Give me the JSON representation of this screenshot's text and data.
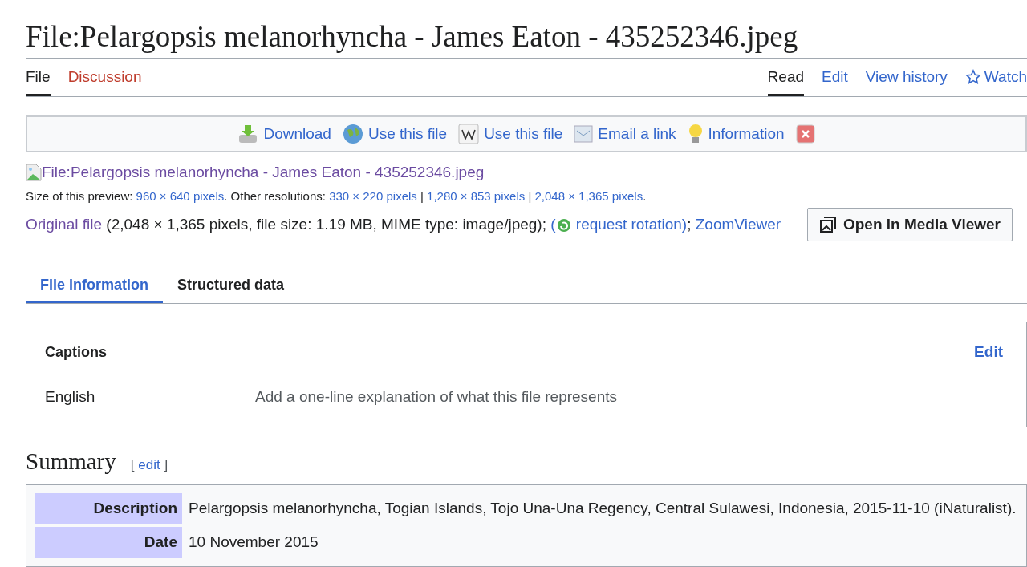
{
  "title": "File:Pelargopsis melanorhyncha - James Eaton - 435252346.jpeg",
  "namespace_tabs": [
    {
      "label": "File",
      "selected": true,
      "kind": "page"
    },
    {
      "label": "Discussion",
      "selected": false,
      "kind": "missing"
    }
  ],
  "view_tabs": [
    {
      "label": "Read",
      "selected": true,
      "kind": "plain"
    },
    {
      "label": "Edit",
      "selected": false,
      "kind": "plain"
    },
    {
      "label": "View history",
      "selected": false,
      "kind": "plain"
    },
    {
      "label": "Watch",
      "selected": false,
      "kind": "star"
    }
  ],
  "toolbar": [
    {
      "label": "Download",
      "kind": "download"
    },
    {
      "label": "Use this file",
      "kind": "globe"
    },
    {
      "label": "Use this file",
      "kind": "wiki"
    },
    {
      "label": "Email a link",
      "kind": "email"
    },
    {
      "label": "Information",
      "kind": "bulb"
    },
    {
      "kind": "close"
    }
  ],
  "preview_link": "File:Pelargopsis melanorhyncha - James Eaton - 435252346.jpeg",
  "size_line": [
    {
      "kind": "text",
      "text": "Size of this preview: "
    },
    {
      "kind": "link",
      "text": "960 × 640 pixels"
    },
    {
      "kind": "text",
      "text": ". Other resolutions: "
    },
    {
      "kind": "link",
      "text": "330 × 220 pixels"
    },
    {
      "kind": "text",
      "text": " | "
    },
    {
      "kind": "link",
      "text": "1,280 × 853 pixels"
    },
    {
      "kind": "text",
      "text": " | "
    },
    {
      "kind": "link",
      "text": "2,048 × 1,365 pixels"
    },
    {
      "kind": "text",
      "text": "."
    }
  ],
  "original_line": [
    {
      "kind": "visited",
      "text": "Original file"
    },
    {
      "kind": "text",
      "text": " (2,048 × 1,365 pixels, file size: 1.19 MB, MIME type: image/jpeg); "
    },
    {
      "kind": "link",
      "text": "("
    },
    {
      "kind": "icon"
    },
    {
      "kind": "link",
      "text": " request rotation)"
    },
    {
      "kind": "text",
      "text": "; "
    },
    {
      "kind": "link",
      "text": "ZoomViewer"
    }
  ],
  "media_viewer_button": "Open in Media Viewer",
  "content_tabs": [
    {
      "label": "File information",
      "selected": true
    },
    {
      "label": "Structured data",
      "selected": false
    }
  ],
  "captions": {
    "heading": "Captions",
    "edit": "Edit",
    "rows": [
      {
        "language": "English",
        "placeholder": "Add a one-line explanation of what this file represents"
      }
    ]
  },
  "summary": {
    "heading": "Summary",
    "edit_open": "[",
    "edit": "edit",
    "edit_close": "]"
  },
  "info_rows": [
    {
      "label": "Description",
      "value": "Pelargopsis melanorhyncha, Togian Islands, Tojo Una-Una Regency, Central Sulawesi, Indonesia, 2015-11-10 (iNaturalist)."
    },
    {
      "label": "Date",
      "value": "10 November 2015"
    }
  ]
}
